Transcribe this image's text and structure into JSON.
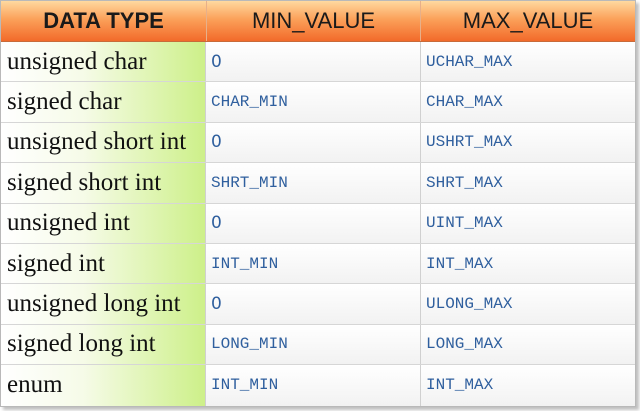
{
  "header": {
    "col1": "DATA TYPE",
    "col2": "MIN_VALUE",
    "col3": "MAX_VALUE"
  },
  "rows": [
    {
      "type": "unsigned char",
      "min": "0",
      "max": "UCHAR_MAX"
    },
    {
      "type": "signed char",
      "min": "CHAR_MIN",
      "max": "CHAR_MAX"
    },
    {
      "type": "unsigned short int",
      "min": "0",
      "max": "USHRT_MAX"
    },
    {
      "type": "signed short int",
      "min": "SHRT_MIN",
      "max": "SHRT_MAX"
    },
    {
      "type": "unsigned int",
      "min": "0",
      "max": "UINT_MAX"
    },
    {
      "type": "signed int",
      "min": "INT_MIN",
      "max": "INT_MAX"
    },
    {
      "type": "unsigned long int",
      "min": "0",
      "max": "ULONG_MAX"
    },
    {
      "type": "signed long int",
      "min": "LONG_MIN",
      "max": "LONG_MAX"
    },
    {
      "type": "enum",
      "min": "INT_MIN",
      "max": "INT_MAX"
    }
  ],
  "colors": {
    "header_top": "#ffd9a0",
    "header_bottom": "#f26a2a",
    "type_cell_green": "#cdf089",
    "value_text": "#2f5f9e"
  }
}
